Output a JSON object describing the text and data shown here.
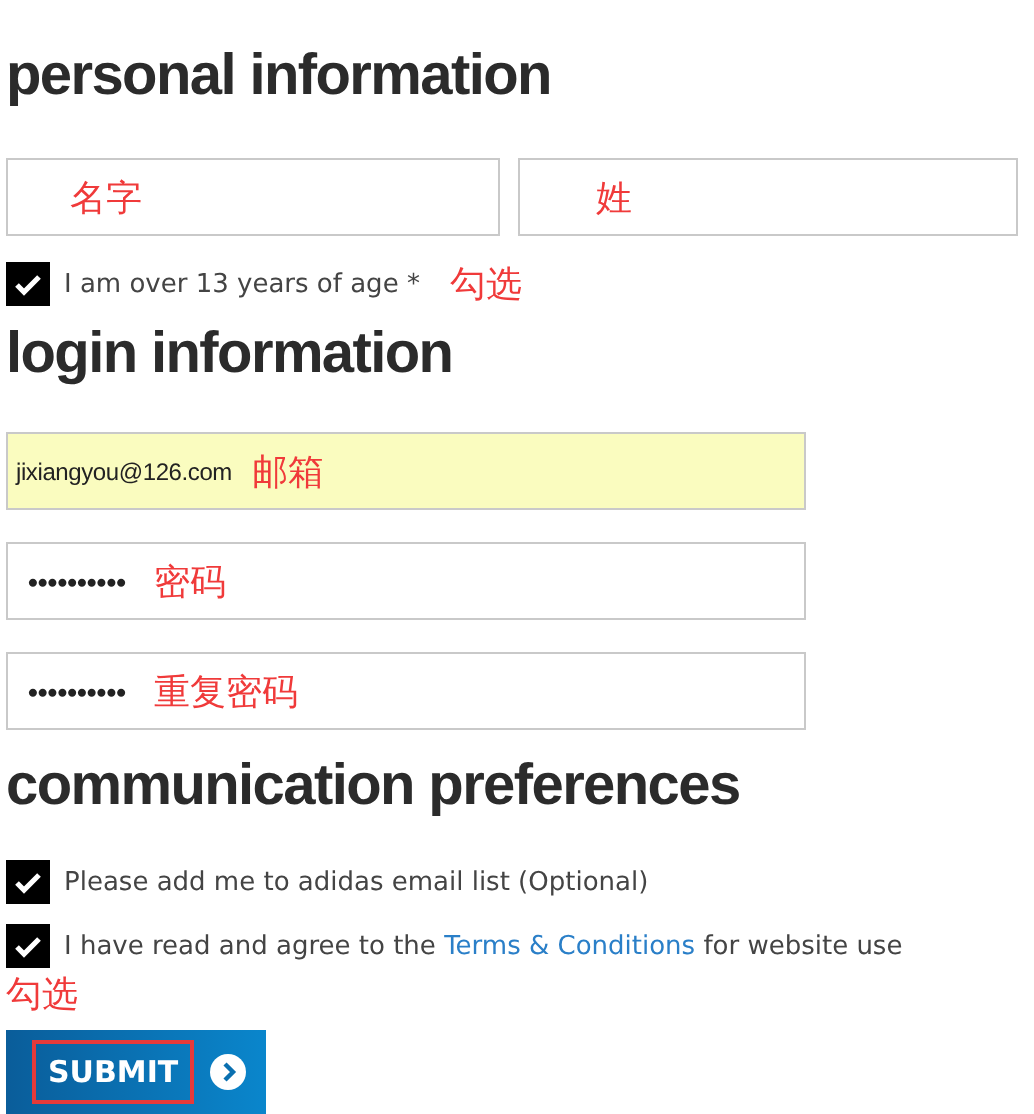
{
  "personal": {
    "heading": "personal information",
    "name_fields": [
      {
        "annotation": "名字"
      },
      {
        "annotation": "姓"
      }
    ],
    "age_check": {
      "label": "I am over 13 years of age *",
      "checked": true,
      "annotation": "勾选"
    }
  },
  "login": {
    "heading": "login information",
    "fields": [
      {
        "kind": "email",
        "value": "jixiangyou@126.com",
        "annotation": "邮箱",
        "autofilled": true
      },
      {
        "kind": "password",
        "value": "••••••••••",
        "annotation": "密码",
        "autofilled": false
      },
      {
        "kind": "password",
        "value": "••••••••••",
        "annotation": "重复密码",
        "autofilled": false
      }
    ]
  },
  "communication": {
    "heading": "communication preferences",
    "checks": [
      {
        "before": "Please add me to adidas email list (Optional)",
        "checked": true
      },
      {
        "before": "I have read and agree to the ",
        "link": "Terms & Conditions",
        "after": " for website use",
        "checked": true
      }
    ],
    "annotation": "勾选"
  },
  "submit": {
    "label": "SUBMIT",
    "highlighted": true
  }
}
